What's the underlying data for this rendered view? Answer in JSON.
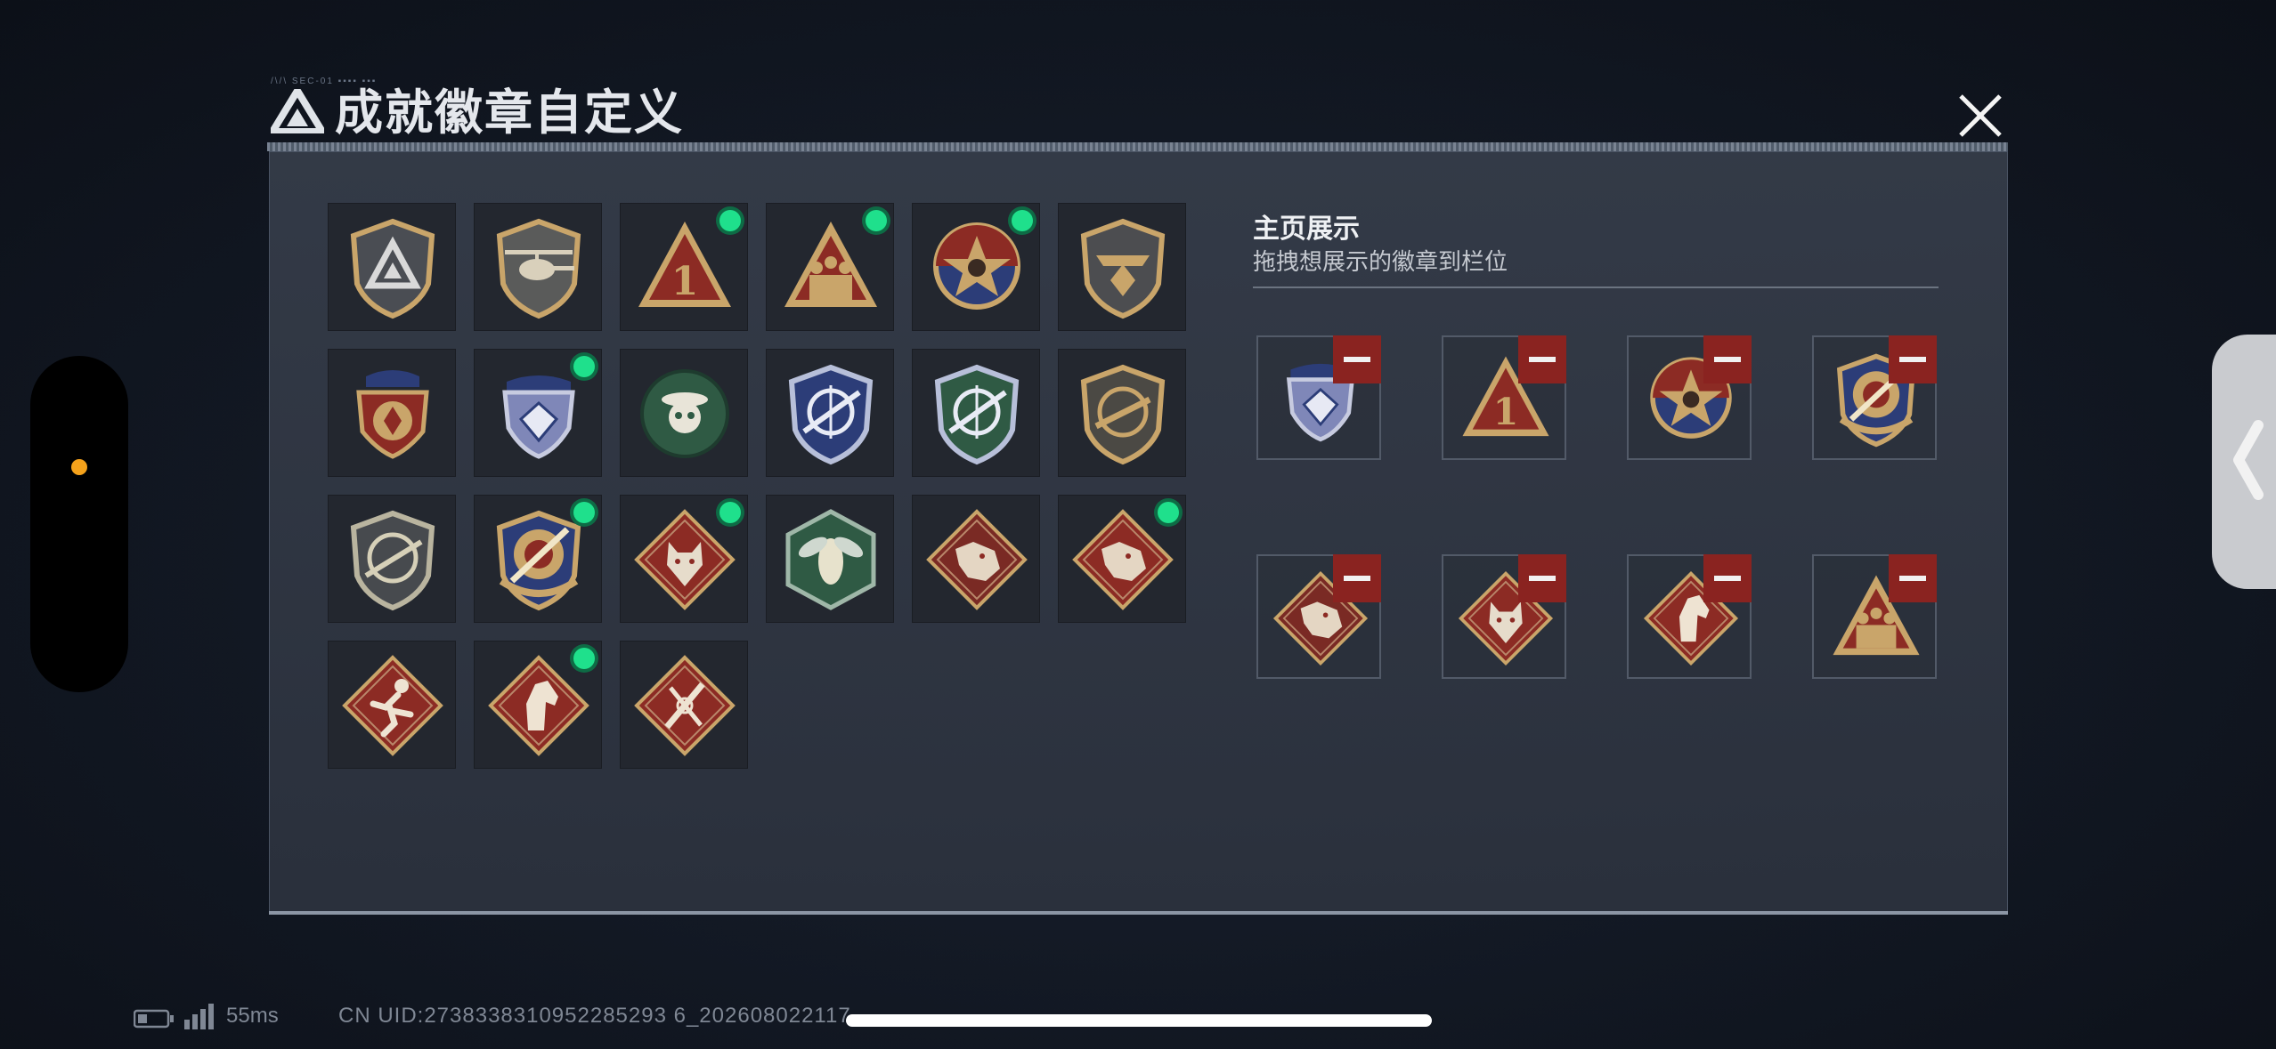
{
  "header": {
    "title": "成就徽章自定义",
    "tick_text": "/\\/\\ SEC-01 ▪▪▪▪ ▪▪▪"
  },
  "showcase": {
    "title": "主页展示",
    "subtitle": "拖拽想展示的徽章到栏位"
  },
  "badges": [
    {
      "icon": "triangle-logo-shield-badge",
      "new": false
    },
    {
      "icon": "helicopter-shield-badge",
      "new": false
    },
    {
      "icon": "number-one-triangle-badge",
      "new": true
    },
    {
      "icon": "soldiers-triangle-badge",
      "new": true
    },
    {
      "icon": "star-skull-medal-badge",
      "new": true
    },
    {
      "icon": "winged-shield-badge",
      "new": false
    },
    {
      "icon": "laurel-crest-badge",
      "new": false
    },
    {
      "icon": "blue-diamond-crest-badge",
      "new": true
    },
    {
      "icon": "green-skull-hat-badge",
      "new": false
    },
    {
      "icon": "sniper-crosshair-blue-badge",
      "new": false
    },
    {
      "icon": "sniper-crosshair-green-badge",
      "new": false
    },
    {
      "icon": "rifle-crosshair-gold-badge",
      "new": false
    },
    {
      "icon": "rifle-crosshair-plain-badge",
      "new": false
    },
    {
      "icon": "gold-target-missile-badge",
      "new": true
    },
    {
      "icon": "wolf-diamond-badge",
      "new": true
    },
    {
      "icon": "hornet-hexagon-badge",
      "new": false
    },
    {
      "icon": "dragon-diamond-badge",
      "new": false
    },
    {
      "icon": "dragon-diamond-red-badge",
      "new": true
    },
    {
      "icon": "runner-diamond-badge",
      "new": false
    },
    {
      "icon": "horse-diamond-badge",
      "new": true
    },
    {
      "icon": "crossed-tools-diamond-badge",
      "new": false
    }
  ],
  "slots": [
    {
      "icon": "blue-diamond-crest-badge"
    },
    {
      "icon": "number-one-triangle-badge"
    },
    {
      "icon": "star-skull-medal-badge"
    },
    {
      "icon": "gold-target-missile-badge"
    },
    {
      "icon": "dragon-diamond-badge"
    },
    {
      "icon": "wolf-diamond-badge"
    },
    {
      "icon": "horse-diamond-badge"
    },
    {
      "icon": "soldiers-triangle-badge"
    }
  ],
  "status": {
    "ping": "55ms",
    "uid": "CN UID:2738338310952285293 6_202608022117"
  },
  "colors": {
    "new_dot": "#1fe08c",
    "remove_button": "#8a2320",
    "badge_gold": "#c9a56a",
    "badge_red": "#8c2b24",
    "badge_blue": "#2c3d78",
    "badge_green": "#2f5a44"
  }
}
